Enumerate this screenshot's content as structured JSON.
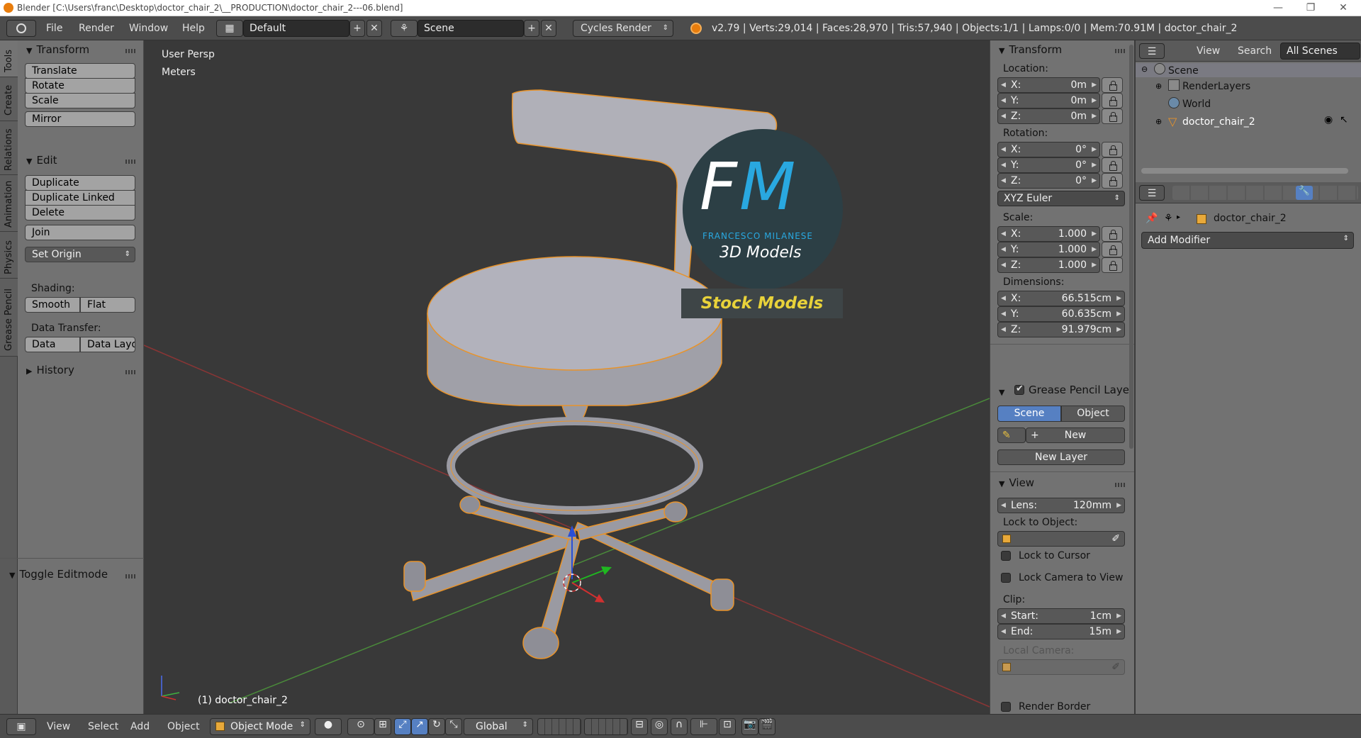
{
  "window": {
    "title": "Blender [C:\\Users\\franc\\Desktop\\doctor_chair_2\\__PRODUCTION\\doctor_chair_2---06.blend]",
    "controls": [
      "—",
      "❐",
      "✕"
    ]
  },
  "infobar": {
    "menus": [
      "File",
      "Render",
      "Window",
      "Help"
    ],
    "layout": "Default",
    "scene": "Scene",
    "engine": "Cycles Render",
    "stats": "v2.79 | Verts:29,014 | Faces:28,970 | Tris:57,940 | Objects:1/1 | Lamps:0/0 | Mem:70.91M | doctor_chair_2"
  },
  "lefttabs": [
    "Tools",
    "Create",
    "Relations",
    "Animation",
    "Physics",
    "Grease Pencil"
  ],
  "toolshelf": {
    "transform_title": "Transform",
    "transform_buttons": [
      "Translate",
      "Rotate",
      "Scale",
      "Mirror"
    ],
    "edit_title": "Edit",
    "edit_buttons": [
      "Duplicate",
      "Duplicate Linked",
      "Delete",
      "Join"
    ],
    "set_origin": "Set Origin",
    "shading_label": "Shading:",
    "shading_smooth": "Smooth",
    "shading_flat": "Flat",
    "data_transfer_label": "Data Transfer:",
    "data": "Data",
    "data_layout": "Data Layo",
    "history_title": "History",
    "toggle_editmode": "Toggle Editmode"
  },
  "viewport": {
    "view_name": "User Persp",
    "units": "Meters",
    "object_label": "(1) doctor_chair_2",
    "watermark": {
      "letters_f": "F",
      "letters_m": "M",
      "author": "FRANCESCO MILANESE",
      "subtitle": "3D Models",
      "banner": "Stock Models"
    }
  },
  "npanel": {
    "transform_title": "Transform",
    "location_label": "Location:",
    "location": [
      {
        "k": "X:",
        "v": "0m"
      },
      {
        "k": "Y:",
        "v": "0m"
      },
      {
        "k": "Z:",
        "v": "0m"
      }
    ],
    "rotation_label": "Rotation:",
    "rotation": [
      {
        "k": "X:",
        "v": "0°"
      },
      {
        "k": "Y:",
        "v": "0°"
      },
      {
        "k": "Z:",
        "v": "0°"
      }
    ],
    "rotation_mode": "XYZ Euler",
    "scale_label": "Scale:",
    "scale": [
      {
        "k": "X:",
        "v": "1.000"
      },
      {
        "k": "Y:",
        "v": "1.000"
      },
      {
        "k": "Z:",
        "v": "1.000"
      }
    ],
    "dimensions_label": "Dimensions:",
    "dimensions": [
      {
        "k": "X:",
        "v": "66.515cm"
      },
      {
        "k": "Y:",
        "v": "60.635cm"
      },
      {
        "k": "Z:",
        "v": "91.979cm"
      }
    ],
    "gp_title": "Grease Pencil Layer",
    "gp_scene": "Scene",
    "gp_object": "Object",
    "gp_new": "New",
    "gp_new_layer": "New Layer",
    "view_title": "View",
    "lens_label": "Lens:",
    "lens_value": "120mm",
    "lock_to_object": "Lock to Object:",
    "lock_to_cursor": "Lock to Cursor",
    "lock_camera": "Lock Camera to View",
    "clip_label": "Clip:",
    "clip_start_label": "Start:",
    "clip_start": "1cm",
    "clip_end_label": "End:",
    "clip_end": "15m",
    "local_camera": "Local Camera:",
    "render_border": "Render Border"
  },
  "outliner": {
    "view": "View",
    "search": "Search",
    "filter": "All Scenes",
    "items": [
      "Scene",
      "RenderLayers",
      "World",
      "doctor_chair_2"
    ]
  },
  "properties": {
    "object_name": "doctor_chair_2",
    "add_modifier": "Add Modifier"
  },
  "viewheader": {
    "menus": [
      "View",
      "Select",
      "Add",
      "Object"
    ],
    "mode": "Object Mode",
    "orientation": "Global"
  },
  "colors": {
    "selection_outline": "#e8932a",
    "accent_blue": "#5680c2",
    "watermark_blue": "#29a8e0",
    "banner_yellow": "#e8d23a"
  }
}
